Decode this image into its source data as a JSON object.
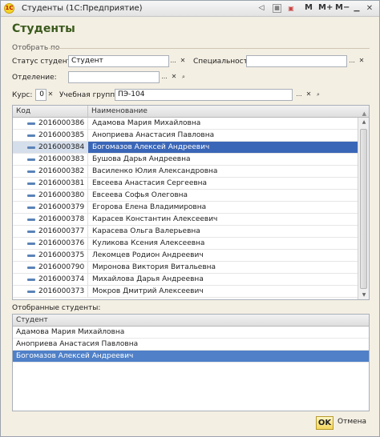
{
  "window": {
    "title": "Студенты  (1С:Предприятие)",
    "toolbar": {
      "m": "M",
      "mplus": "M+",
      "mminus": "M−"
    }
  },
  "heading": "Студенты",
  "filter": {
    "group_label": "Отобрать по",
    "status_label": "Статус студента:",
    "status_value": "Студент",
    "specialty_label": "Специальность:",
    "specialty_value": "",
    "department_label": "Отделение:",
    "department_value": "",
    "course_label": "Курс:",
    "course_value": "0",
    "group_label2": "Учебная группа:",
    "group_value": "ПЭ-104",
    "choose_btn": "...",
    "clear_btn": "✕",
    "open_btn": "🔍"
  },
  "list": {
    "col_code": "Код",
    "col_name": "Наименование",
    "rows": [
      {
        "code": "2016000386",
        "name": "Адамова Мария Михайловна",
        "selected": false
      },
      {
        "code": "2016000385",
        "name": "Аноприева Анастасия Павловна",
        "selected": false
      },
      {
        "code": "2016000384",
        "name": "Богомазов Алексей Андреевич",
        "selected": true
      },
      {
        "code": "2016000383",
        "name": "Бушова Дарья Андреевна",
        "selected": false
      },
      {
        "code": "2016000382",
        "name": "Василенко Юлия Александровна",
        "selected": false
      },
      {
        "code": "2016000381",
        "name": "Евсеева Анастасия Сергеевна",
        "selected": false
      },
      {
        "code": "2016000380",
        "name": "Евсеева Софья Олеговна",
        "selected": false
      },
      {
        "code": "2016000379",
        "name": "Егорова Елена Владимировна",
        "selected": false
      },
      {
        "code": "2016000378",
        "name": "Карасев Константин Алексеевич",
        "selected": false
      },
      {
        "code": "2016000377",
        "name": "Карасева Ольга Валерьевна",
        "selected": false
      },
      {
        "code": "2016000376",
        "name": "Куликова Ксения Алексеевна",
        "selected": false
      },
      {
        "code": "2016000375",
        "name": "Лекомцев Родион Андреевич",
        "selected": false
      },
      {
        "code": "2016000790",
        "name": "Миронова Виктория Витальевна",
        "selected": false
      },
      {
        "code": "2016000374",
        "name": "Михайлова Дарья Андреевна",
        "selected": false
      },
      {
        "code": "2016000373",
        "name": "Мокров Дмитрий Алексеевич",
        "selected": false
      }
    ]
  },
  "selected_students": {
    "label": "Отобранные студенты:",
    "col_student": "Студент",
    "rows": [
      {
        "name": "Адамова Мария Михайловна",
        "selected": false
      },
      {
        "name": "Аноприева Анастасия Павловна",
        "selected": false
      },
      {
        "name": "Богомазов Алексей Андреевич",
        "selected": true
      }
    ]
  },
  "buttons": {
    "ok": "OK",
    "cancel": "Отмена"
  }
}
